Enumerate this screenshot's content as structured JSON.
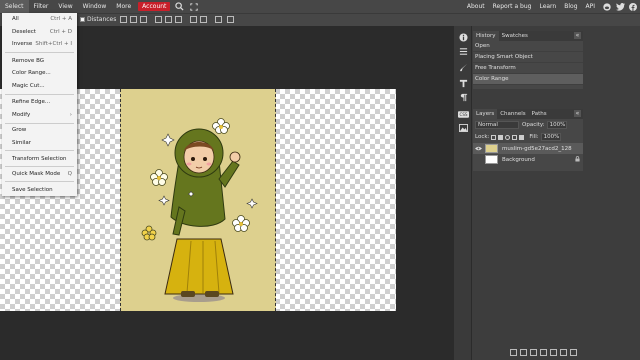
{
  "menubar": {
    "items": [
      "Select",
      "Filter",
      "View",
      "Window",
      "More"
    ],
    "account_label": "Account",
    "links": [
      "About",
      "Report a bug",
      "Learn",
      "Blog",
      "API"
    ],
    "icons": [
      "search-icon",
      "fullscreen-icon",
      "reddit-icon",
      "twitter-icon",
      "facebook-icon"
    ],
    "accent_color": "#c8202a"
  },
  "toolbar": {
    "distances_label": "Distances"
  },
  "select_menu": {
    "items": [
      {
        "label": "All",
        "shortcut": "Ctrl + A"
      },
      {
        "label": "Deselect",
        "shortcut": "Ctrl + D"
      },
      {
        "label": "Inverse",
        "shortcut": "Shift+Ctrl + I"
      },
      {
        "label": "Remove BG",
        "shortcut": ""
      },
      {
        "label": "Color Range...",
        "shortcut": ""
      },
      {
        "label": "Magic Cut...",
        "shortcut": ""
      },
      {
        "label": "Refine Edge...",
        "shortcut": ""
      },
      {
        "label": "Modify",
        "shortcut": "›"
      },
      {
        "label": "Grow",
        "shortcut": ""
      },
      {
        "label": "Similar",
        "shortcut": ""
      },
      {
        "label": "Transform Selection",
        "shortcut": ""
      },
      {
        "label": "Quick Mask Mode",
        "shortcut": "Q"
      },
      {
        "label": "Save Selection",
        "shortcut": ""
      }
    ]
  },
  "history_panel": {
    "tabs": [
      "History",
      "Swatches"
    ],
    "collapse_glyph": "«",
    "rows": [
      "Open",
      "Placing Smart Object",
      "Free Transform",
      "Color Range"
    ],
    "selected_index": 3
  },
  "layers_panel": {
    "tabs": [
      "Layers",
      "Channels",
      "Paths"
    ],
    "blend_mode": "Normal",
    "opacity_label": "Opacity:",
    "opacity_value": "100%",
    "lock_label": "Lock:",
    "fill_label": "Fill:",
    "fill_value": "100%",
    "layers": [
      {
        "name": "muslim-gd5e27acd2_128",
        "selected": true
      },
      {
        "name": "Background",
        "selected": false
      }
    ]
  },
  "side_tools": [
    "info-icon",
    "properties-icon",
    "brush-settings-icon",
    "character-icon",
    "paragraph-icon",
    "css-icon",
    "image-icon"
  ]
}
